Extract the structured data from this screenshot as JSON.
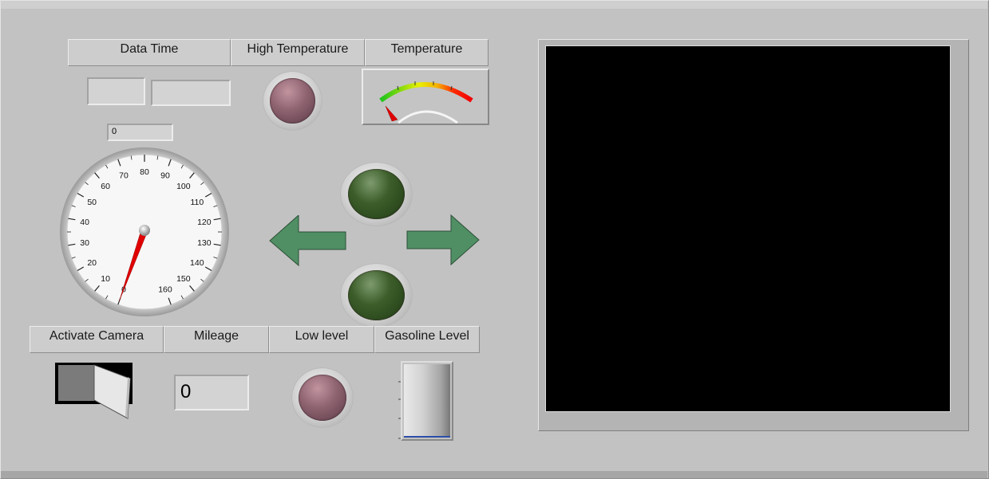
{
  "headers": {
    "data_time": "Data Time",
    "high_temperature": "High Temperature",
    "temperature": "Temperature",
    "activate_camera": "Activate Camera",
    "mileage": "Mileage",
    "low_level": "Low level",
    "gasoline_level": "Gasoline Level"
  },
  "date_field": "",
  "time_field": "",
  "speed_readout": "0",
  "mileage_value": "0",
  "speedometer": {
    "value": 0,
    "min": 0,
    "max": 160,
    "tick_labels": [
      "0",
      "10",
      "20",
      "30",
      "40",
      "50",
      "60",
      "70",
      "80",
      "90",
      "100",
      "110",
      "120",
      "130",
      "140",
      "150",
      "160"
    ]
  },
  "gasoline_level": 0,
  "camera_switch_on": false,
  "colors": {
    "panel": "#c0c0c0",
    "arrow_fill": "#4f8f63",
    "needle": "#e00000",
    "display": "#000000"
  },
  "icons": {
    "left_arrow": "left-arrow-icon",
    "right_arrow": "right-arrow-icon"
  }
}
